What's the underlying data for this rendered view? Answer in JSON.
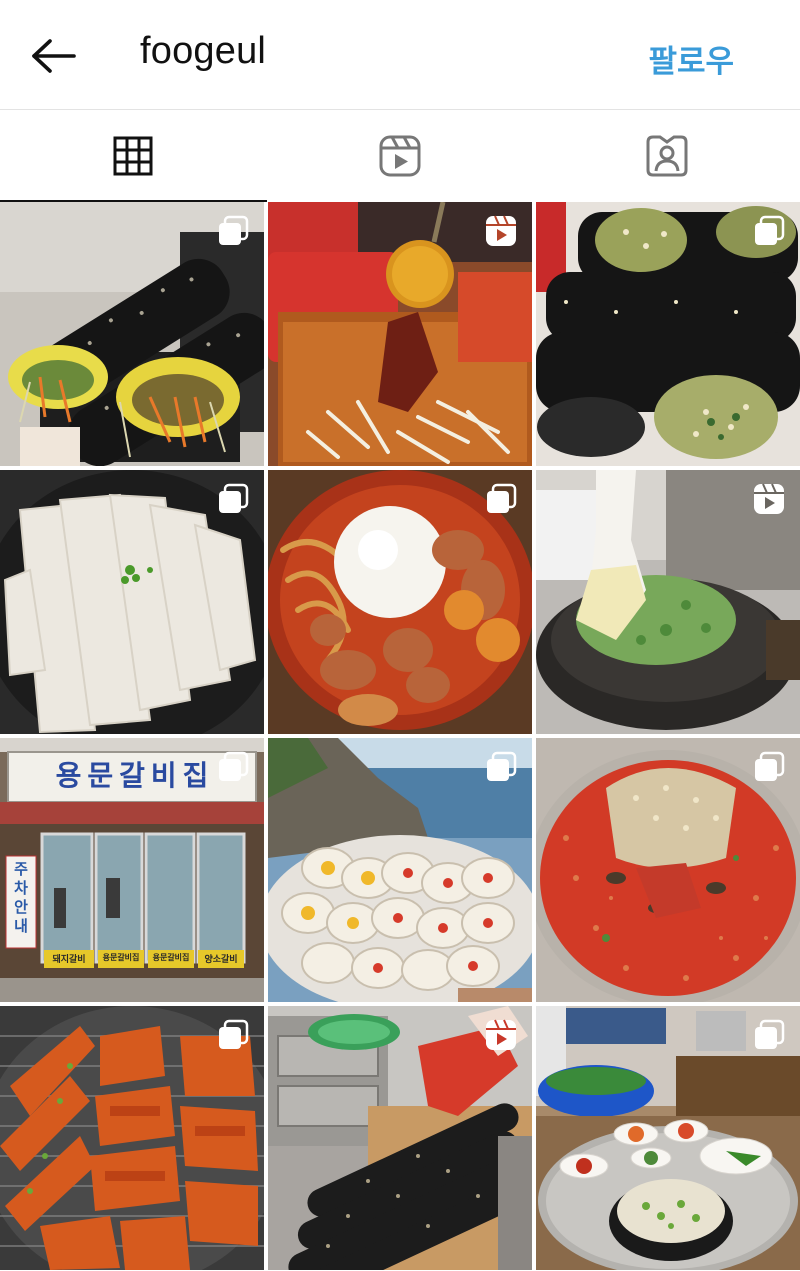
{
  "header": {
    "username": "foogeul",
    "follow_label": "팔로우"
  },
  "icons": {
    "back": "arrow-left-icon",
    "grid_tab": "grid-icon",
    "reels_tab": "reels-icon",
    "tagged_tab": "tagged-person-icon",
    "carousel": "multiple-posts-icon",
    "reel": "reel-icon"
  },
  "colors": {
    "follow": "#3a9bd9",
    "active_tab": "#111111",
    "inactive_tab": "#777777"
  },
  "posts": [
    {
      "type": "carousel",
      "subject": "gimbap-egg"
    },
    {
      "type": "reel",
      "subject": "tteokbokki-sauce"
    },
    {
      "type": "carousel",
      "subject": "gimbap-rolls"
    },
    {
      "type": "carousel",
      "subject": "rice-noodle-sheets"
    },
    {
      "type": "carousel",
      "subject": "spicy-stew-rice"
    },
    {
      "type": "reel",
      "subject": "pancake-griddle"
    },
    {
      "type": "carousel",
      "subject": "restaurant-storefront",
      "sign": "용문갈비집",
      "side_sign": "주차 안내",
      "banners": [
        "돼지갈비",
        "용문갈비집",
        "용문갈비집",
        "양소갈비"
      ]
    },
    {
      "type": "carousel",
      "subject": "grilled-scallops-sea"
    },
    {
      "type": "carousel",
      "subject": "cold-noodle-sesame"
    },
    {
      "type": "carousel",
      "subject": "grilled-pork-ribs"
    },
    {
      "type": "reel",
      "subject": "gimbap-making"
    },
    {
      "type": "carousel",
      "subject": "soup-side-dishes"
    }
  ]
}
